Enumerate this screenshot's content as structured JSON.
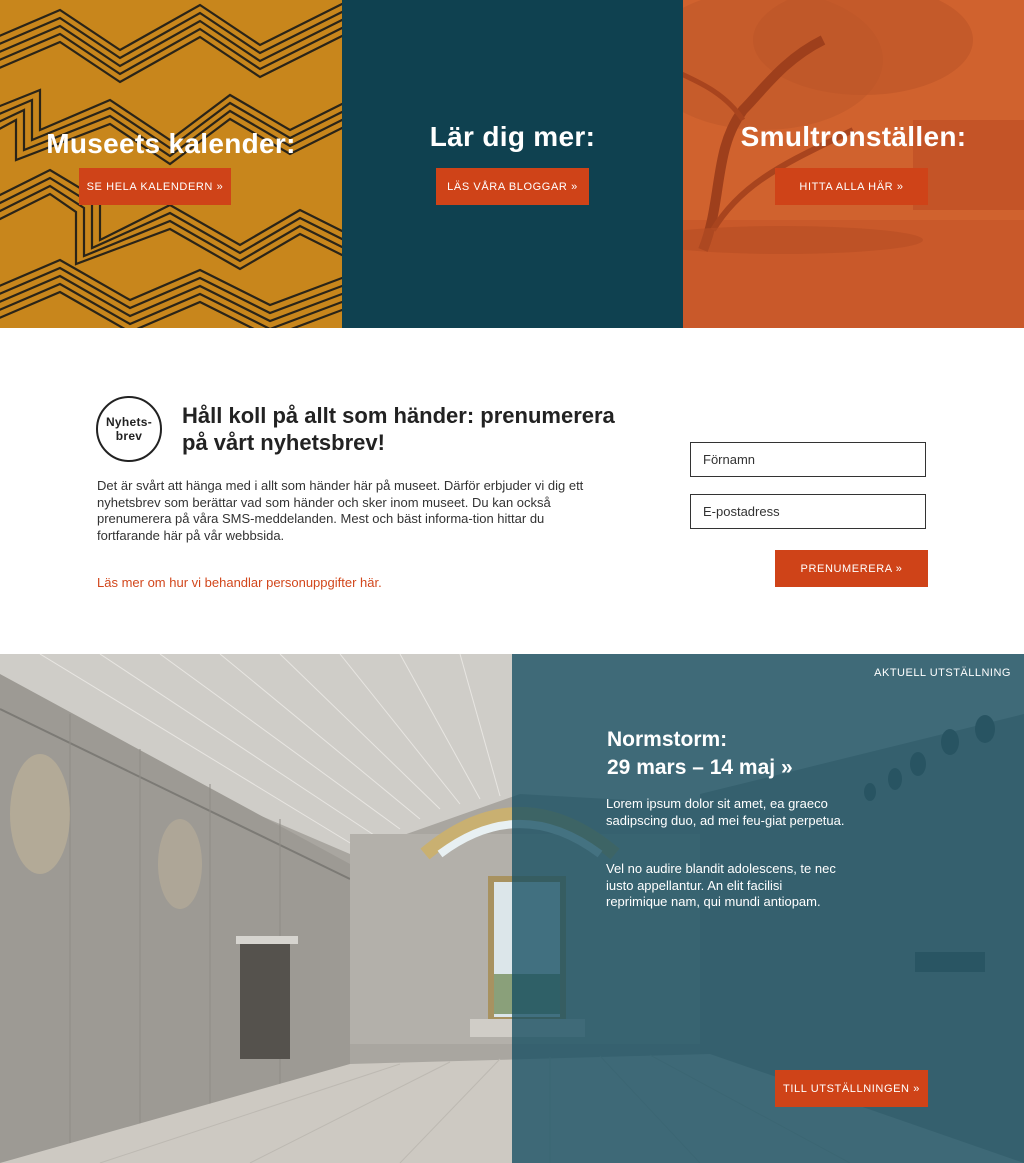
{
  "tiles": [
    {
      "title": "Museets kalender:",
      "button": "SE HELA KALENDERN  »",
      "color": "#c8861c"
    },
    {
      "title": "Lär dig mer:",
      "button": "LÄS VÅRA  BLOGGAR  »",
      "color": "#0f4150"
    },
    {
      "title": "Smultronställen:",
      "button": "HITTA ALLA HÄR  »",
      "color": "#d0622e"
    }
  ],
  "newsletter": {
    "badge_line1": "Nyhets-",
    "badge_line2": "brev",
    "heading": "Håll koll på allt som händer: prenumerera på vårt nyhetsbrev!",
    "body": "Det är svårt att hänga med i allt som händer här på museet. Därför erbjuder vi dig ett nyhetsbrev som berättar vad som händer och sker inom museet. Du kan också prenumerera på våra SMS-meddelanden. Mest och bäst informa-tion hittar du fortfarande här på vår webbsida.",
    "privacy_link": "Läs mer om hur vi behandlar personuppgifter här.",
    "first_name_placeholder": "Förnamn",
    "email_placeholder": "E-postadress",
    "submit": "PRENUMERERA »"
  },
  "exhibition": {
    "tag": "AKTUELL UTSTÄLLNING",
    "title_line1": "Normstorm:",
    "title_line2": "29 mars – 14 maj »",
    "paragraph1": "Lorem ipsum dolor sit amet, ea graeco sadipscing duo, ad mei feu-giat perpetua.",
    "paragraph2": "Vel no audire blandit adolescens, te nec iusto appellantur. An elit facilisi reprimique nam, qui mundi antiopam.",
    "button": "TILL UTSTÄLLNINGEN »"
  },
  "colors": {
    "accent": "#cf4318",
    "overlay": "#164e62"
  }
}
